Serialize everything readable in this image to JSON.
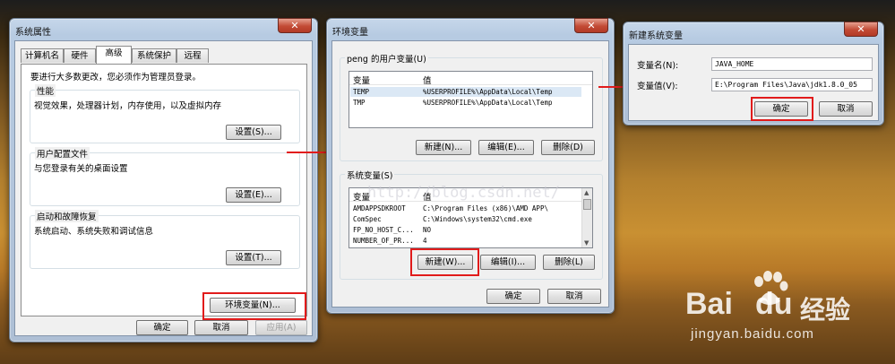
{
  "sys_props": {
    "title": "系统属性",
    "close": "✕",
    "tabs": [
      "计算机名",
      "硬件",
      "高级",
      "系统保护",
      "远程"
    ],
    "admin_note": "要进行大多数更改，您必须作为管理员登录。",
    "perf": {
      "label": "性能",
      "desc": "视觉效果，处理器计划，内存使用，以及虚拟内存",
      "button": "设置(S)..."
    },
    "profile": {
      "label": "用户配置文件",
      "desc": "与您登录有关的桌面设置",
      "button": "设置(E)..."
    },
    "startup": {
      "label": "启动和故障恢复",
      "desc": "系统启动、系统失败和调试信息",
      "button": "设置(T)..."
    },
    "env_button": "环境变量(N)...",
    "ok": "确定",
    "cancel": "取消",
    "apply": "应用(A)"
  },
  "env_vars": {
    "title": "环境变量",
    "close": "✕",
    "user_group": "peng 的用户变量(U)",
    "col_var": "变量",
    "col_val": "值",
    "user_rows": [
      {
        "name": "TEMP",
        "value": "%USERPROFILE%\\AppData\\Local\\Temp"
      },
      {
        "name": "TMP",
        "value": "%USERPROFILE%\\AppData\\Local\\Temp"
      }
    ],
    "user_new": "新建(N)...",
    "user_edit": "编辑(E)...",
    "user_delete": "删除(D)",
    "sys_group": "系统变量(S)",
    "sys_rows": [
      {
        "name": "AMDAPPSDKROOT",
        "value": "C:\\Program Files (x86)\\AMD APP\\"
      },
      {
        "name": "ComSpec",
        "value": "C:\\Windows\\system32\\cmd.exe"
      },
      {
        "name": "FP_NO_HOST_C...",
        "value": "NO"
      },
      {
        "name": "NUMBER_OF_PR...",
        "value": "4"
      }
    ],
    "sys_new": "新建(W)...",
    "sys_edit": "编辑(I)...",
    "sys_delete": "删除(L)",
    "ok": "确定",
    "cancel": "取消"
  },
  "new_var": {
    "title": "新建系统变量",
    "close": "✕",
    "name_label": "变量名(N):",
    "name_value": "JAVA_HOME",
    "value_label": "变量值(V):",
    "value_value": "E:\\Program Files\\Java\\jdk1.8.0_05",
    "ok": "确定",
    "cancel": "取消"
  },
  "watermark": {
    "url": "http://blog.csdn.net/",
    "logo_a": "Bai",
    "logo_b": "du",
    "logo_c": "经验",
    "site": "jingyan.baidu.com"
  },
  "colors": {
    "highlight": "#e11b1b",
    "arrow": "#e11b1b"
  }
}
